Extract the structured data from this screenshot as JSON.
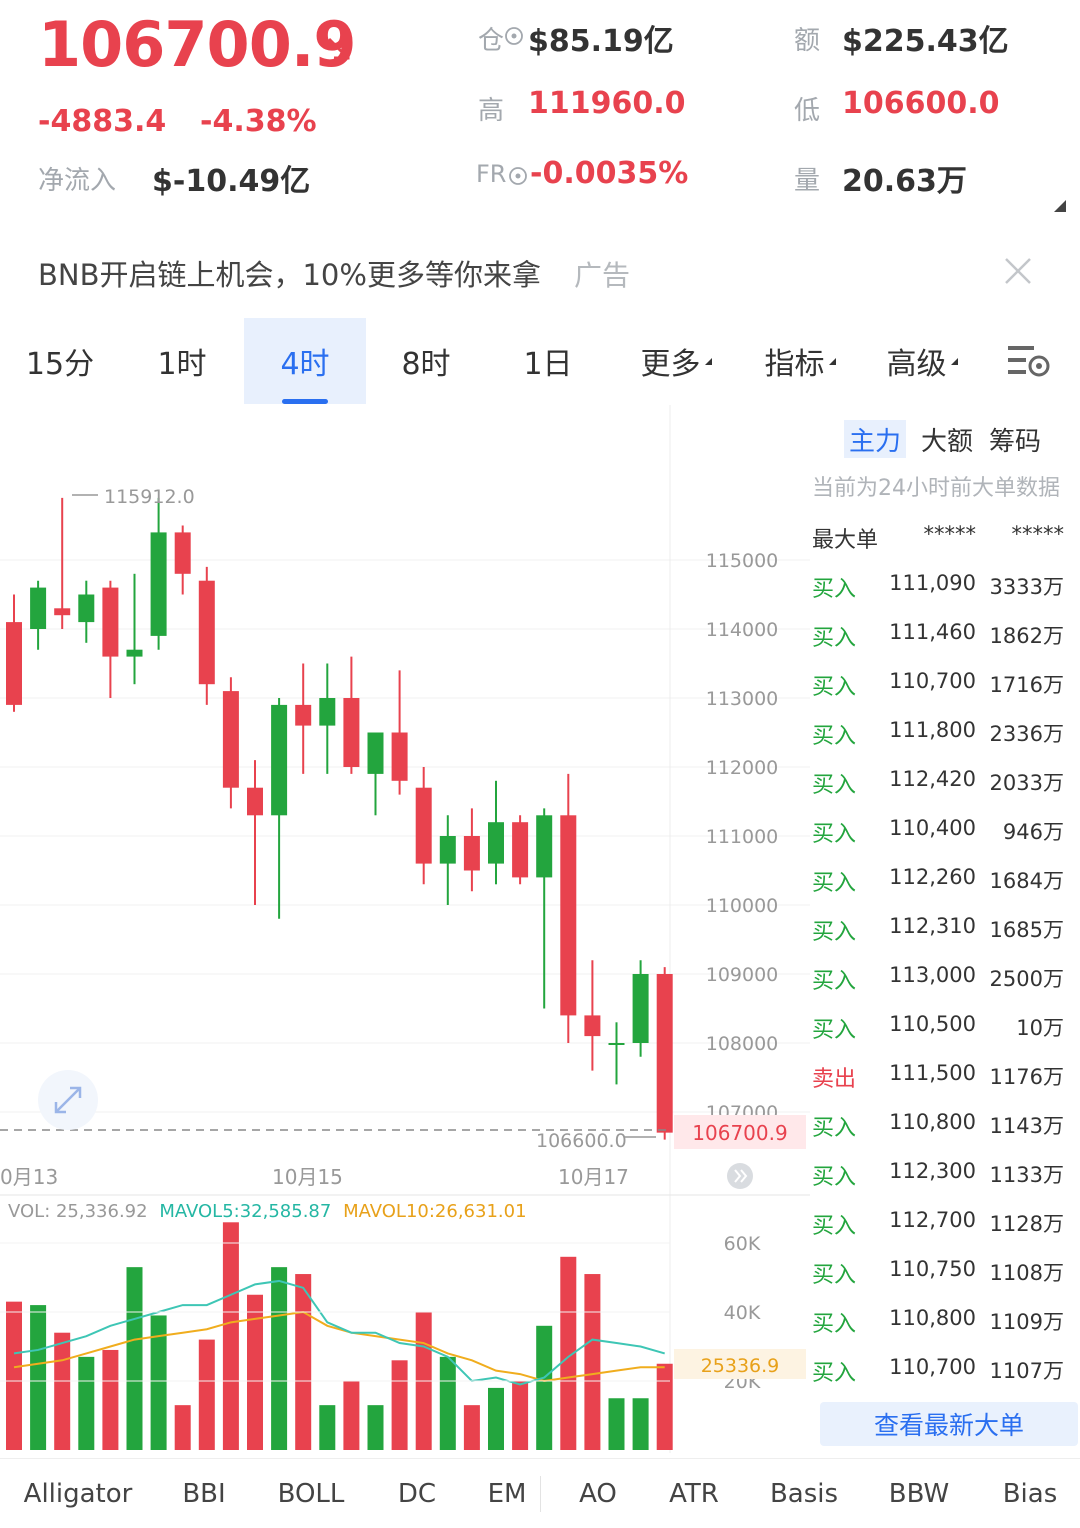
{
  "header": {
    "price": "106700.9",
    "change": "-4883.4",
    "change_pct": "-4.38%",
    "netflow_label": "净流入",
    "netflow_value": "$-10.49亿",
    "oi_label": "仓",
    "oi_value": "$85.19亿",
    "high_label": "高",
    "high_value": "111960.0",
    "fr_label": "FR",
    "fr_value": "-0.0035%",
    "amount_label": "额",
    "amount_value": "$225.43亿",
    "low_label": "低",
    "low_value": "106600.0",
    "volume_label": "量",
    "volume_value": "20.63万"
  },
  "banner": {
    "text": "BNB开启链上机会，10%更多等你来拿",
    "tag": "广告"
  },
  "tabs": [
    "15分",
    "1时",
    "4时",
    "8时",
    "1日",
    "更多",
    "指标",
    "高级"
  ],
  "active_tab": "4时",
  "chart": {
    "y_ticks": [
      "115000",
      "114000",
      "113000",
      "112000",
      "111000",
      "110000",
      "109000",
      "108000",
      "107000"
    ],
    "high_label": "115912.0",
    "low_label": "106600.0",
    "current_label": "106700.9",
    "x_labels": [
      "0月13",
      "10月15",
      "10月17"
    ],
    "vol_legend": {
      "vol": "VOL: 25,336.92",
      "mavol5": "MAVOL5:32,585.87",
      "mavol10": "MAVOL10:26,631.01"
    },
    "vol_ticks": [
      "60K",
      "40K",
      "20K"
    ],
    "vol_current": "25336.9",
    "colors": {
      "up": "#23a53e",
      "down": "#e8424e",
      "ma5": "#3ec6b5",
      "ma10": "#f0ad1e"
    }
  },
  "right_panel": {
    "tabs": [
      "主力",
      "大额",
      "筹码"
    ],
    "note": "当前为24小时前大单数据",
    "header": {
      "type": "最大单",
      "price": "*****",
      "amount": "*****"
    },
    "orders": [
      {
        "type": "买入",
        "price": "111,090",
        "amount": "3333万"
      },
      {
        "type": "买入",
        "price": "111,460",
        "amount": "1862万"
      },
      {
        "type": "买入",
        "price": "110,700",
        "amount": "1716万"
      },
      {
        "type": "买入",
        "price": "111,800",
        "amount": "2336万"
      },
      {
        "type": "买入",
        "price": "112,420",
        "amount": "2033万"
      },
      {
        "type": "买入",
        "price": "110,400",
        "amount": "946万"
      },
      {
        "type": "买入",
        "price": "112,260",
        "amount": "1684万"
      },
      {
        "type": "买入",
        "price": "112,310",
        "amount": "1685万"
      },
      {
        "type": "买入",
        "price": "113,000",
        "amount": "2500万"
      },
      {
        "type": "买入",
        "price": "110,500",
        "amount": "10万"
      },
      {
        "type": "卖出",
        "price": "111,500",
        "amount": "1176万"
      },
      {
        "type": "买入",
        "price": "110,800",
        "amount": "1143万"
      },
      {
        "type": "买入",
        "price": "112,300",
        "amount": "1133万"
      },
      {
        "type": "买入",
        "price": "112,700",
        "amount": "1128万"
      },
      {
        "type": "买入",
        "price": "110,750",
        "amount": "1108万"
      },
      {
        "type": "买入",
        "price": "110,800",
        "amount": "1109万"
      },
      {
        "type": "买入",
        "price": "110,700",
        "amount": "1107万"
      }
    ],
    "button": "查看最新大单"
  },
  "indicators": [
    "Alligator",
    "BBI",
    "BOLL",
    "DC",
    "EM",
    "AO",
    "ATR",
    "Basis",
    "BBW",
    "Bias"
  ],
  "chart_data": {
    "type": "candlestick",
    "candles": [
      {
        "o": 114100,
        "h": 114500,
        "l": 112800,
        "c": 112900
      },
      {
        "o": 114000,
        "h": 114700,
        "l": 113700,
        "c": 114600
      },
      {
        "o": 114300,
        "h": 115900,
        "l": 114000,
        "c": 114200
      },
      {
        "o": 114100,
        "h": 114700,
        "l": 113800,
        "c": 114500
      },
      {
        "o": 114600,
        "h": 114700,
        "l": 113000,
        "c": 113600
      },
      {
        "o": 113600,
        "h": 114800,
        "l": 113200,
        "c": 113700
      },
      {
        "o": 113900,
        "h": 115900,
        "l": 113700,
        "c": 115400
      },
      {
        "o": 115400,
        "h": 115500,
        "l": 114500,
        "c": 114800
      },
      {
        "o": 114700,
        "h": 114900,
        "l": 112900,
        "c": 113200
      },
      {
        "o": 113100,
        "h": 113300,
        "l": 111400,
        "c": 111700
      },
      {
        "o": 111700,
        "h": 112100,
        "l": 110000,
        "c": 111300
      },
      {
        "o": 111300,
        "h": 113000,
        "l": 109800,
        "c": 112900
      },
      {
        "o": 112900,
        "h": 113500,
        "l": 111900,
        "c": 112600
      },
      {
        "o": 112600,
        "h": 113500,
        "l": 111900,
        "c": 113000
      },
      {
        "o": 113000,
        "h": 113600,
        "l": 111900,
        "c": 112000
      },
      {
        "o": 111900,
        "h": 112500,
        "l": 111300,
        "c": 112500
      },
      {
        "o": 112500,
        "h": 113400,
        "l": 111600,
        "c": 111800
      },
      {
        "o": 111700,
        "h": 112000,
        "l": 110300,
        "c": 110600
      },
      {
        "o": 110600,
        "h": 111300,
        "l": 110000,
        "c": 111000
      },
      {
        "o": 111000,
        "h": 111400,
        "l": 110200,
        "c": 110500
      },
      {
        "o": 110600,
        "h": 111800,
        "l": 110300,
        "c": 111200
      },
      {
        "o": 111200,
        "h": 111300,
        "l": 110300,
        "c": 110400
      },
      {
        "o": 110400,
        "h": 111400,
        "l": 108500,
        "c": 111300
      },
      {
        "o": 111300,
        "h": 111900,
        "l": 108000,
        "c": 108400
      },
      {
        "o": 108400,
        "h": 109200,
        "l": 107600,
        "c": 108100
      },
      {
        "o": 108000,
        "h": 108300,
        "l": 107400,
        "c": 108000
      },
      {
        "o": 108000,
        "h": 109200,
        "l": 107800,
        "c": 109000
      },
      {
        "o": 109000,
        "h": 109100,
        "l": 106600,
        "c": 106700.9
      }
    ],
    "volume": [
      43,
      42,
      34,
      27,
      29,
      53,
      39,
      13,
      32,
      66,
      45,
      53,
      51,
      13,
      20,
      13,
      26,
      40,
      27,
      13,
      18,
      20,
      36,
      56,
      51,
      15,
      15,
      25
    ],
    "mavol5": [
      28,
      29,
      31,
      33,
      36,
      38,
      40,
      42,
      42,
      45,
      48,
      49,
      47,
      37,
      34,
      34,
      31,
      30,
      27,
      20,
      21,
      19,
      21,
      27,
      32,
      31,
      30,
      28
    ],
    "mavol10": [
      24,
      25,
      26,
      28,
      30,
      32,
      33,
      34,
      35,
      37,
      38,
      39,
      40,
      36,
      34,
      33,
      32,
      31,
      28,
      26,
      23,
      22,
      20,
      21,
      22,
      23,
      24,
      24
    ],
    "ylim": [
      106600,
      116000
    ],
    "vol_ylim": [
      0,
      70
    ]
  }
}
